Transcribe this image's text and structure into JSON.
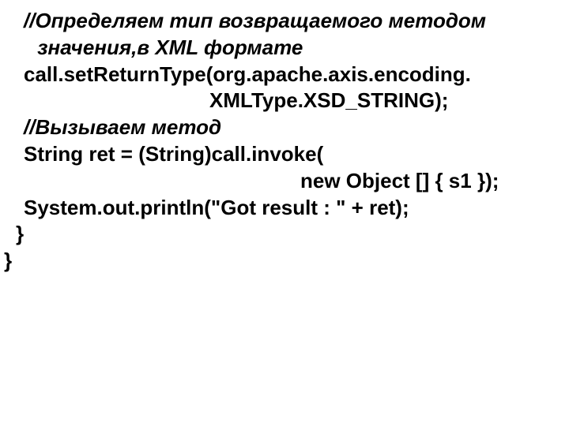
{
  "code": {
    "comment1_line1": "//Определяем тип возвращаемого методом",
    "comment1_line2": " значения,в XML формате",
    "setReturn_line1": "call.setReturnType(org.apache.axis.encoding.",
    "setReturn_line2": "XMLType.XSD_STRING);",
    "comment2": "//Вызываем метод",
    "invoke_line1": "String ret = (String)call.invoke(",
    "invoke_line2": "new Object [] { s1 });",
    "println": "System.out.println(\"Got result : \" + ret);",
    "brace_inner": "}",
    "brace_outer": "}"
  }
}
